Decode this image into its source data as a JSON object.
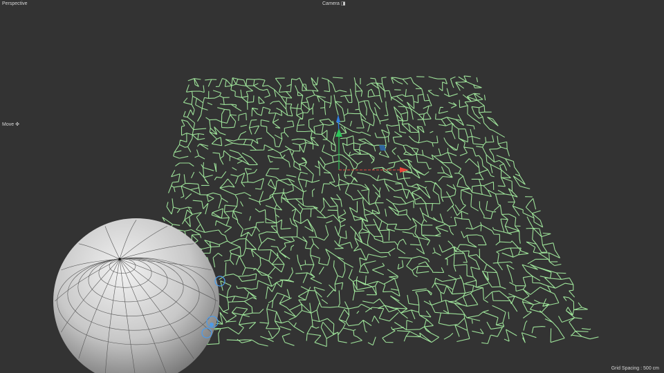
{
  "viewport": {
    "view_name": "Perspective",
    "camera_label": "Camera",
    "camera_icon": "camera-menu-icon",
    "tool_label": "Move",
    "tool_icon": "move-crosshair-icon",
    "grid_spacing": "Grid Spacing : 500 cm"
  },
  "colors": {
    "background": "#333333",
    "wireframe": "#9ee39a",
    "sphere": "#c9c9c9",
    "axis_x": "#e8473b",
    "axis_y": "#2ec45a",
    "axis_z": "#2f7de0"
  }
}
